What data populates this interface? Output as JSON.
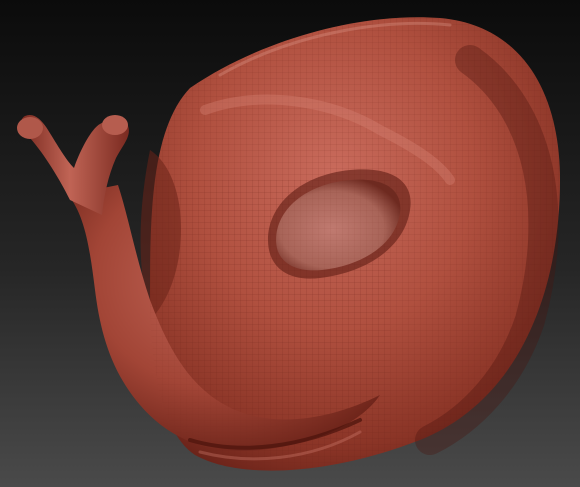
{
  "scene": {
    "subject": "sculpted-creature-head",
    "colors": {
      "background_top": "#0b0b0b",
      "background_bottom": "#4a4a4a",
      "clay_light": "#c96b5c",
      "clay_mid": "#a8473a",
      "clay_dark": "#5e1c14",
      "eye_socket": "#b06a60",
      "wireframe": "#7a2a20"
    }
  }
}
